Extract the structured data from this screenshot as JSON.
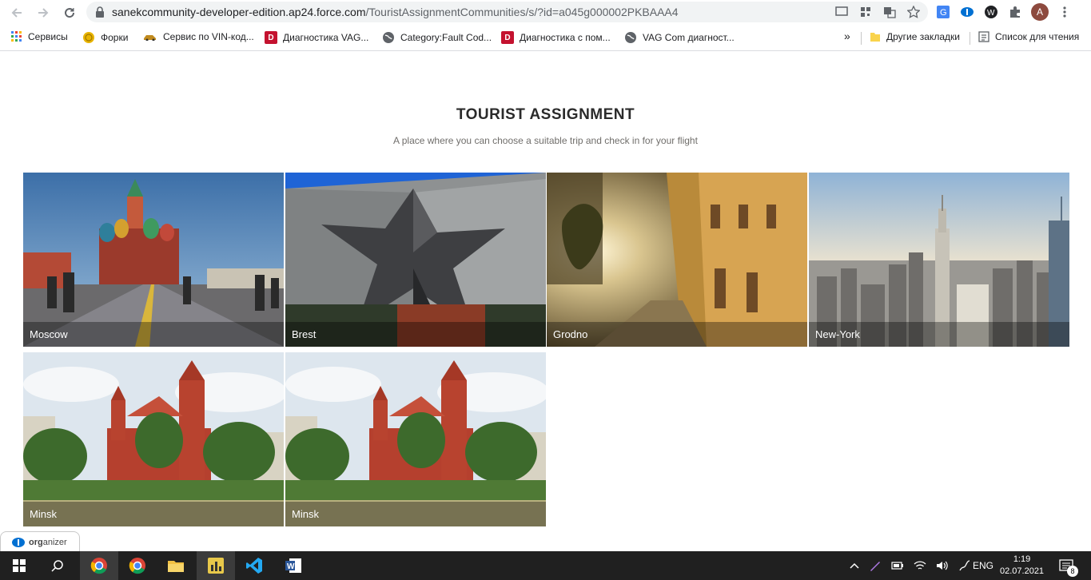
{
  "browser": {
    "url_host": "sanekcommunity-developer-edition.ap24.force.com",
    "url_path": "/TouristAssignmentCommunities/s/?id=a045g000002PKBAAA4",
    "avatar_letter": "A"
  },
  "bookmarks": [
    {
      "label": "Сервисы",
      "icon": "apps-grid-icon"
    },
    {
      "label": "Форки",
      "icon": "coin-icon"
    },
    {
      "label": "Сервис по VIN-код...",
      "icon": "car-icon"
    },
    {
      "label": "Диагностика VAG...",
      "icon": "d-logo-icon"
    },
    {
      "label": "Category:Fault Cod...",
      "icon": "globe-icon"
    },
    {
      "label": "Диагностика с пом...",
      "icon": "d-logo-icon"
    },
    {
      "label": "VAG Com диагност...",
      "icon": "globe-icon"
    }
  ],
  "bookmarks_right": {
    "more": "»",
    "other_label": "Другие закладки",
    "reading_label": "Список для чтения"
  },
  "page": {
    "title": "TOURIST ASSIGNMENT",
    "subtitle": "A place where you can choose a suitable trip and check in for your flight"
  },
  "tiles": [
    {
      "label": "Moscow"
    },
    {
      "label": "Brest"
    },
    {
      "label": "Grodno"
    },
    {
      "label": "New-York"
    },
    {
      "label": "Minsk"
    },
    {
      "label": "Minsk"
    }
  ],
  "organizer": {
    "label_bold": "org",
    "label_rest": "anizer"
  },
  "taskbar": {
    "lang": "ENG",
    "time": "1:19",
    "date": "02.07.2021",
    "notifications": "8"
  },
  "colors": {
    "brand_blue": "#0070d2",
    "taskbar": "#202020"
  }
}
